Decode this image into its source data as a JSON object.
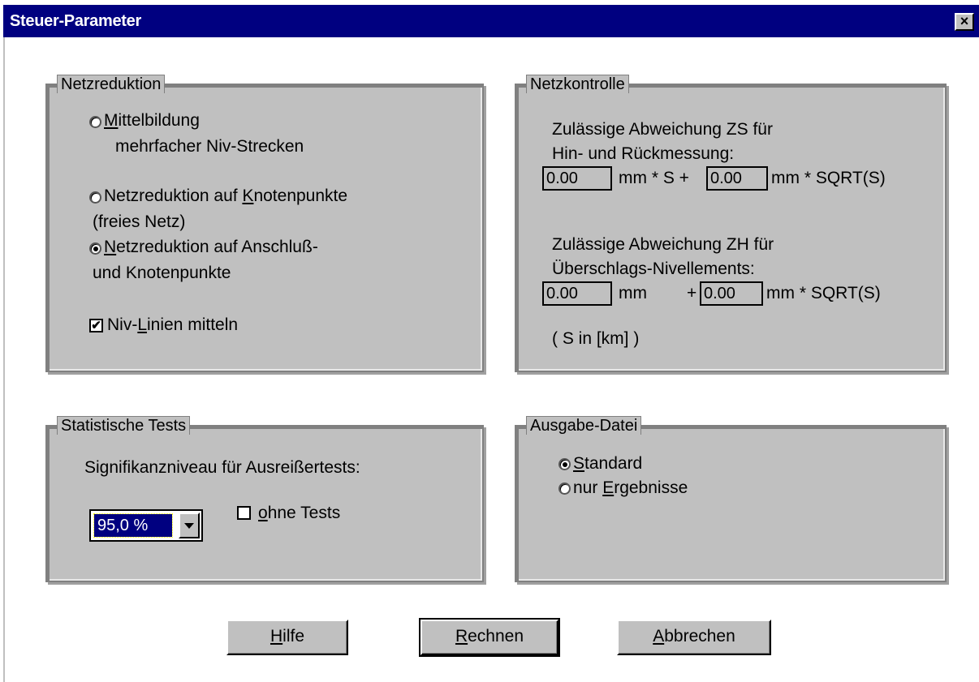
{
  "window": {
    "title": "Steuer-Parameter",
    "close_label": "×"
  },
  "netzreduktion": {
    "legend": "Netzreduktion",
    "opt1": {
      "mnemonic": "M",
      "rest": "ittelbildung",
      "line2": "mehrfacher Niv-Strecken",
      "selected": false
    },
    "opt2": {
      "pre": "Netzreduktion auf ",
      "mnemonic": "K",
      "rest": "notenpunkte",
      "line2": "(freies Netz)",
      "selected": false
    },
    "opt3": {
      "mnemonic": "N",
      "rest": "etzreduktion auf Anschluß-",
      "line2": "und Knotenpunkte",
      "selected": true
    },
    "checkbox": {
      "pre": "Niv-",
      "mnemonic": "L",
      "rest": "inien mitteln",
      "checked": true,
      "mark": "✔"
    }
  },
  "netzkontrolle": {
    "legend": "Netzkontrolle",
    "zs_line1": "Zulässige Abweichung ZS für",
    "zs_line2": "Hin- und Rückmessung:",
    "zs_a_value": "0.00",
    "zs_a_unit": "mm * S +",
    "zs_b_value": "0.00",
    "zs_b_unit": "mm * SQRT(S)",
    "zh_line1": "Zulässige Abweichung ZH für",
    "zh_line2": "Überschlags-Nivellements:",
    "zh_a_value": "0.00",
    "zh_a_unit": "mm",
    "zh_plus": "+",
    "zh_b_value": "0.00",
    "zh_b_unit": "mm * SQRT(S)",
    "note": "( S in [km] )"
  },
  "statistische_tests": {
    "legend": "Statistische Tests",
    "label": "Signifikanzniveau für Ausreißertests:",
    "selected_level": "95,0 %",
    "ohne_tests": {
      "mnemonic": "o",
      "rest": "hne Tests",
      "checked": false
    }
  },
  "ausgabe_datei": {
    "legend": "Ausgabe-Datei",
    "standard": {
      "mnemonic": "S",
      "rest": "tandard",
      "selected": true
    },
    "nur_ergebnisse": {
      "pre": "nur ",
      "mnemonic": "E",
      "rest": "rgebnisse",
      "selected": false
    }
  },
  "buttons": {
    "hilfe": {
      "mnemonic": "H",
      "rest": "ilfe"
    },
    "rechnen": {
      "mnemonic": "R",
      "rest": "echnen"
    },
    "abbrechen": {
      "mnemonic": "A",
      "rest": "bbrechen"
    }
  }
}
